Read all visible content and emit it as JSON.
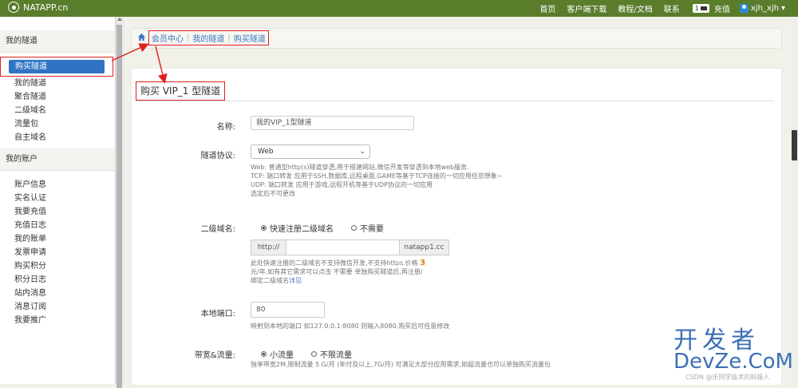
{
  "app": {
    "brand": "NATAPP.cn"
  },
  "nav": {
    "items": [
      "首页",
      "客户端下载",
      "教程/文档",
      "联系"
    ],
    "balance_badge": "1",
    "recharge": "充值",
    "user": "xjh_xjh",
    "user_caret": "▾"
  },
  "sidebar": {
    "sections": [
      {
        "title": "我的隧道",
        "items": [
          "购买隧道",
          "我的隧道",
          "聚合隧道",
          "二级域名",
          "流量包",
          "自主域名"
        ]
      },
      {
        "title": "我的账户",
        "items": [
          "账户信息",
          "实名认证",
          "我要充值",
          "充值日志",
          "我的账单",
          "发票申请",
          "购买积分",
          "积分日志",
          "站内消息",
          "消息订阅",
          "我要推广"
        ]
      }
    ],
    "active_item": "购买隧道"
  },
  "breadcrumb": [
    "会员中心",
    "我的隧道",
    "购买隧道"
  ],
  "page_title": "购买 VIP_1 型隧道",
  "form": {
    "name": {
      "label": "名称:",
      "value": "我的VIP_1型隧道"
    },
    "protocol": {
      "label": "隧道协议:",
      "value": "Web",
      "help": [
        "Web: 普通型http(s)隧道穿透,用于搭建网站,微信开发等穿透到本地web服务.",
        "TCP: 端口转发 应用于SSH,数据库,远程桌面,GAME等基于TCP连接的一切应用任您想象~",
        "UDP: 端口转发 应用于游戏,远程开机等基于UDP协议的一切应用",
        "选定后不可更改"
      ]
    },
    "subdomain": {
      "label": "二级域名:",
      "options": [
        "快速注册二级域名",
        "不需要"
      ],
      "selected": 0,
      "prefix": "http://",
      "suffix": "natapp1.cc",
      "value": "",
      "help_1": "此处快速注册的二级域名不支持微信开发,不支持https.价格",
      "price": "3",
      "help_2": "元/年.如有其它需求可以点击 不需要 单独购买隧道后,再注册/",
      "help_3": "绑定二级域名",
      "help_link": "详见"
    },
    "local_port": {
      "label": "本地端口:",
      "value": "80",
      "help": "映射到本地的端口 如127.0.0.1:8080 则输入8080.购买后可任意修改"
    },
    "bandwidth": {
      "label": "带宽&流量:",
      "options": [
        "小流量",
        "不限流量"
      ],
      "selected": 0,
      "help": "独享带宽2M,限制流量 5 G/月 (年付及以上,7G/月) 可满足大部分应用需求,如超流量也可以单独购买流量包"
    }
  },
  "watermark": {
    "cn": "开发者",
    "en": "DevZe.CoM",
    "source": "CSDN @乐同学技术的科级人"
  },
  "colors": {
    "navbar": "#5a7d2c",
    "active": "#3073c4",
    "annotation": "#e02020",
    "link": "#3d77c0"
  }
}
